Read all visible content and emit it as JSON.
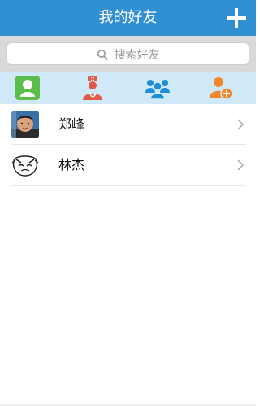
{
  "header": {
    "title": "我的好友",
    "add_icon": "plus-icon"
  },
  "search": {
    "placeholder": "搜索好友",
    "icon": "search-icon"
  },
  "icon_bar": {
    "items": [
      {
        "icon": "contact-icon",
        "color": "#5bbd4a"
      },
      {
        "icon": "doctor-icon",
        "color": "#e35a4a"
      },
      {
        "icon": "group-icon",
        "color": "#1e8fd6"
      },
      {
        "icon": "add-person-icon",
        "color": "#f0882a"
      }
    ]
  },
  "friends": [
    {
      "name": "郑峰"
    },
    {
      "name": "林杰"
    }
  ],
  "colors": {
    "header_bg": "#2f8fd1",
    "icon_bar_bg": "#cfe9f8",
    "search_bg": "#d9d9d9"
  }
}
